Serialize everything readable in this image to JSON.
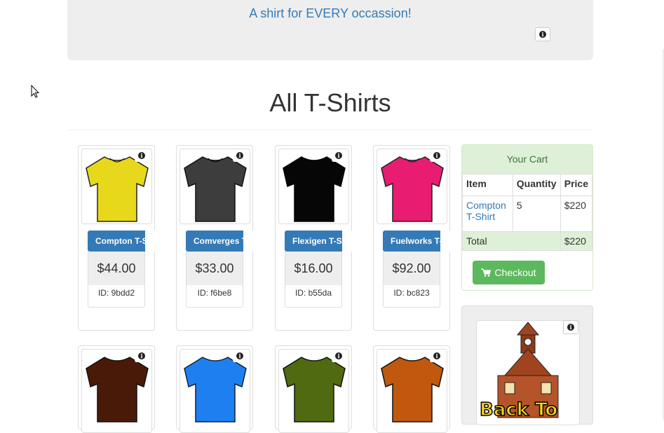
{
  "header": {
    "tagline": "A shirt for EVERY occassion!",
    "info_icon": "info-circle-icon"
  },
  "page": {
    "title": "All T-Shirts"
  },
  "products": [
    {
      "name": "Compton T-Shirt",
      "price": "$44.00",
      "id": "ID: 9bdd2",
      "color": "#e8d81c"
    },
    {
      "name": "Comverges T-Shirt",
      "price": "$33.00",
      "id": "ID: f6be8",
      "color": "#3d3d3d"
    },
    {
      "name": "Flexigen T-Shirt",
      "price": "$16.00",
      "id": "ID: b55da",
      "color": "#060606"
    },
    {
      "name": "Fuelworks T-Shirt",
      "price": "$92.00",
      "id": "ID: bc823",
      "color": "#e81c70"
    },
    {
      "color": "#4a1a08"
    },
    {
      "color": "#1e80f0"
    },
    {
      "color": "#4f6a10"
    },
    {
      "color": "#c0580e"
    }
  ],
  "cart": {
    "title": "Your Cart",
    "headers": [
      "Item",
      "Quantity",
      "Price"
    ],
    "rows": [
      {
        "item": "Compton T-Shirt",
        "quantity": "5",
        "price": "$220"
      }
    ],
    "total_label": "Total",
    "total_value": "$220",
    "checkout_label": "Checkout",
    "checkout_icon": "shopping-cart-icon"
  },
  "promo": {
    "image": "back-to-school-schoolhouse-image",
    "text": "Back To"
  }
}
